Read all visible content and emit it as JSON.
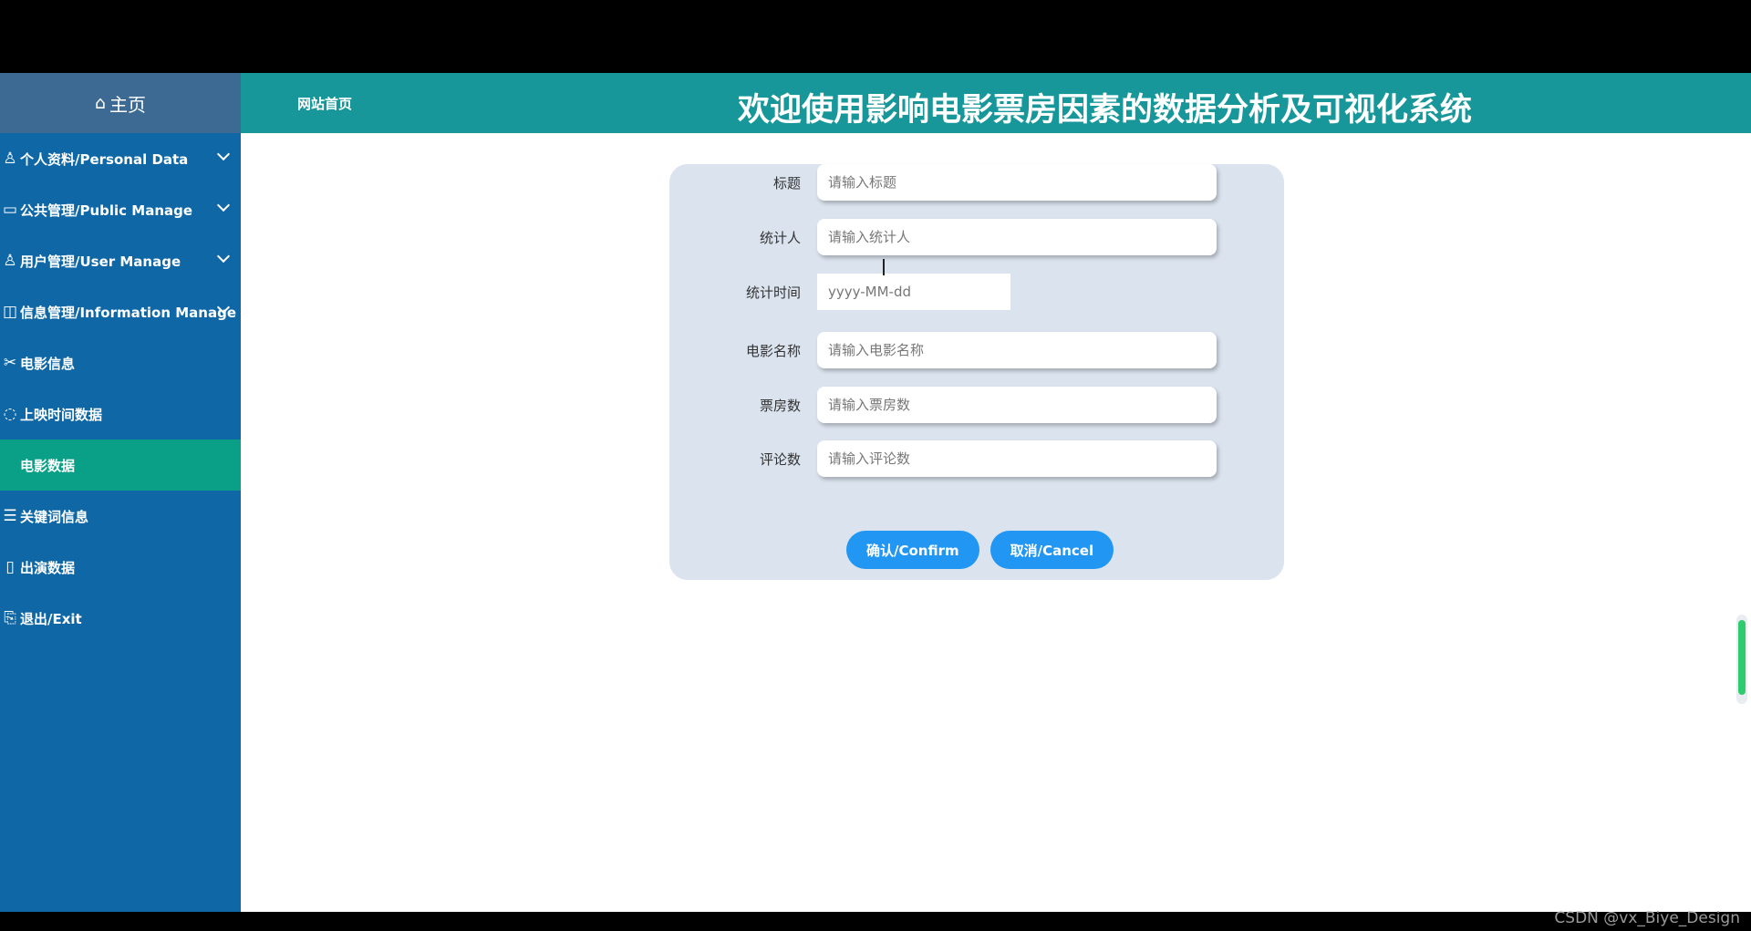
{
  "sidebar": {
    "home_label": "主页",
    "items": [
      {
        "label": "个人资料/Personal Data",
        "icon": "user-icon",
        "expandable": true
      },
      {
        "label": "公共管理/Public Manage",
        "icon": "monitor-icon",
        "expandable": true
      },
      {
        "label": "用户管理/User Manage",
        "icon": "user-manage-icon",
        "expandable": true
      },
      {
        "label": "信息管理/Information Manage",
        "icon": "info-icon",
        "expandable": true
      },
      {
        "label": "电影信息",
        "icon": "film-icon",
        "expandable": false
      },
      {
        "label": "上映时间数据",
        "icon": "clock-user-icon",
        "expandable": false
      },
      {
        "label": "电影数据",
        "icon": "",
        "expandable": false,
        "active": true
      },
      {
        "label": "关键词信息",
        "icon": "list-icon",
        "expandable": false
      },
      {
        "label": "出演数据",
        "icon": "book-icon",
        "expandable": false
      },
      {
        "label": "退出/Exit",
        "icon": "exit-icon",
        "expandable": false
      }
    ]
  },
  "header": {
    "site_link": "网站首页",
    "title": "欢迎使用影响电影票房因素的数据分析及可视化系统"
  },
  "form": {
    "fields": [
      {
        "label": "标题",
        "placeholder": "请输入标题"
      },
      {
        "label": "统计人",
        "placeholder": "请输入统计人"
      },
      {
        "label": "统计时间",
        "placeholder": "yyyy-MM-dd"
      },
      {
        "label": "电影名称",
        "placeholder": "请输入电影名称"
      },
      {
        "label": "票房数",
        "placeholder": "请输入票房数"
      },
      {
        "label": "评论数",
        "placeholder": "请输入评论数"
      }
    ],
    "confirm_label": "确认/Confirm",
    "cancel_label": "取消/Cancel"
  },
  "watermark": "CSDN @vx_Biye_Design",
  "colors": {
    "sidebar": "#0f67a6",
    "header": "#17979a",
    "active_item": "#0aa088",
    "button": "#2196f3",
    "card": "#dbe3ee"
  }
}
